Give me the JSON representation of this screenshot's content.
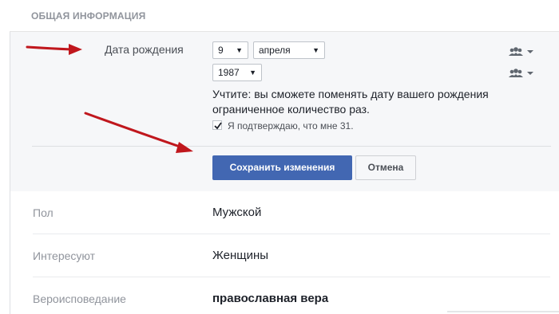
{
  "section": {
    "title": "ОБЩАЯ ИНФОРМАЦИЯ"
  },
  "birthday": {
    "label": "Дата рождения",
    "day": "9",
    "month": "апреля",
    "year": "1987",
    "note": "Учтите: вы сможете поменять дату вашего рождения ограниченное количество раз.",
    "confirm_text": "Я подтверждаю, что мне 31.",
    "confirm_checked": true
  },
  "privacy_icon": "friends-audience-icon",
  "buttons": {
    "save_label": "Сохранить изменения",
    "cancel_label": "Отмена"
  },
  "rows": [
    {
      "label": "Пол",
      "value": "Мужской"
    },
    {
      "label": "Интересуют",
      "value": "Женщины"
    },
    {
      "label": "Вероисповедание",
      "value": "православная вера"
    }
  ],
  "colors": {
    "primary_button": "#4267b2",
    "panel_background": "#f6f7f9",
    "annotation_arrow": "#c0171d"
  }
}
